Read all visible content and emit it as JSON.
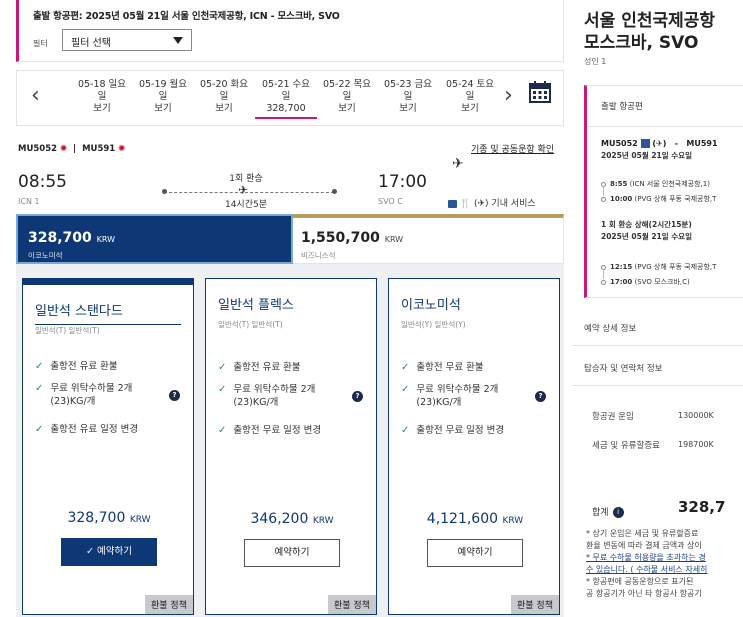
{
  "flight_header": {
    "title": "출발 항공편: 2025년 05월 21일 서울 인천국제공항, ICN - 모스크바, SVO",
    "filter_label": "필터",
    "filter_value": "필터 선택"
  },
  "date_bar": {
    "dates": [
      {
        "date": "05-18 일요",
        "line2": "일",
        "price": "보기",
        "active": false
      },
      {
        "date": "05-19 월요",
        "line2": "일",
        "price": "보기",
        "active": false
      },
      {
        "date": "05-20 화요",
        "line2": "일",
        "price": "보기",
        "active": false
      },
      {
        "date": "05-21 수요",
        "line2": "일",
        "price": "328,700",
        "active": true
      },
      {
        "date": "05-22 목요",
        "line2": "일",
        "price": "보기",
        "active": false
      },
      {
        "date": "05-23 금요",
        "line2": "일",
        "price": "보기",
        "active": false
      },
      {
        "date": "05-24 토요",
        "line2": "일",
        "price": "보기",
        "active": false
      }
    ],
    "prev_icon": "‹",
    "next_icon": "›"
  },
  "flight": {
    "codes": [
      "MU5052",
      "MU591"
    ],
    "dep_time": "08:55",
    "arr_time": "17:00",
    "dep_airport": "ICN 1",
    "arr_airport": "SVO C",
    "stops": "1회 환승",
    "duration": "14시간5분",
    "codeshare": "기종 및 공동운항 확인",
    "services": "기내 서비스"
  },
  "fare_classes": {
    "economy": {
      "amount": "328,700",
      "currency": "KRW",
      "label": "이코노미석"
    },
    "business": {
      "amount": "1,550,700",
      "currency": "KRW",
      "label": "비즈니스석"
    }
  },
  "options": [
    {
      "title": "일반석 스탠다드",
      "sub": "일반석(T) 일반석(T)",
      "features": [
        "출항전 유료 환불",
        "무료 위탁수하물 2개 (23)KG/개",
        "출항전 유료 일정 변경"
      ],
      "price": "328,700",
      "currency": "KRW",
      "button": "✓ 예약하기",
      "refund": "환불 정책",
      "selected": true
    },
    {
      "title": "일반석 플렉스",
      "sub": "일반석(T) 일반석(T)",
      "features": [
        "출항전 유료 환불",
        "무료 위탁수하물 2개 (23)KG/개",
        "출항전 무료 일정 변경"
      ],
      "price": "346,200",
      "currency": "KRW",
      "button": "예약하기",
      "refund": "환불 정책",
      "selected": false
    },
    {
      "title": "이코노미석",
      "sub": "일반석(Y) 일반석(Y)",
      "features": [
        "출항전 무료 환불",
        "무료 위탁수하물 2개 (23)KG/개",
        "출항전 무료 일정 변경"
      ],
      "price": "4,121,600",
      "currency": "KRW",
      "button": "예약하기",
      "refund": "환불 정책",
      "selected": false
    }
  ],
  "summary": {
    "title_line1": "서울 인천국제공항",
    "title_line2": "모스크바, SVO",
    "pax": "성인 1",
    "section_header": "출발 항공편",
    "flight_line": "MU5052",
    "flight_dash": "-",
    "flight_line2": "MU591",
    "flight_date": "2025년 05월 21일 수요일",
    "stop1_time": "8:55",
    "stop1_place": "(ICN 서울 인천국제공항,1)",
    "stop2_time": "10:00",
    "stop2_place": "(PVG 상해 푸동 국제공항,T",
    "transfer": "1 회 환승 상해(2시간15분)",
    "transfer_date": "2025년 05월 21일 수요일",
    "stop3_time": "12:15",
    "stop3_place": "(PVG 상해 푸동 국제공항,T",
    "stop4_time": "17:00",
    "stop4_place": "(SVO 모스크바,C)",
    "booking_details": "예약 상세 정보",
    "contact": "탑승자 및 연락처 정보",
    "fare_label": "항공권 운임",
    "fare_value": "130000K",
    "tax_label": "세금 및 유류할증료",
    "tax_value": "198700K",
    "total_label": "합계",
    "total_value": "328,7",
    "note1": "* 상기 운임은 세금 및 유류할증료",
    "note2": "환율 변동에 따라 결제 금액과 상이",
    "note3": "* 무료 수하물 허용량을 초과하는 경",
    "note4": "수 있습니다. ( 수하물 서비스 자세히",
    "note5": "* 항공편에 공동운항으로 표기된",
    "note6": "공 항공기가 아닌 타 항공사 항공기"
  },
  "icons": {
    "calendar": "calendar-icon",
    "plane": "plane-icon",
    "check": "check-icon",
    "help": "help-icon"
  },
  "colors": {
    "navy": "#0e3775",
    "accent": "#c8197c",
    "gold": "#b99b5a"
  }
}
